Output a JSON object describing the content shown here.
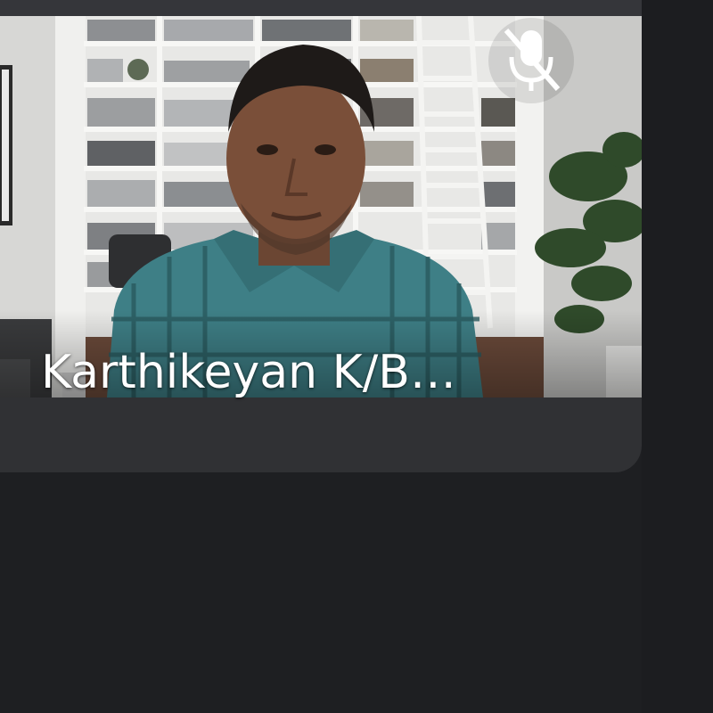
{
  "participant": {
    "name": "Karthikeyan K/B…",
    "mic_status_icon": "mic-off-icon",
    "video_icon": "participant-video"
  },
  "colors": {
    "page_background": "#1e1f22",
    "tile_background": "#303134",
    "name_text": "#ffffff"
  }
}
